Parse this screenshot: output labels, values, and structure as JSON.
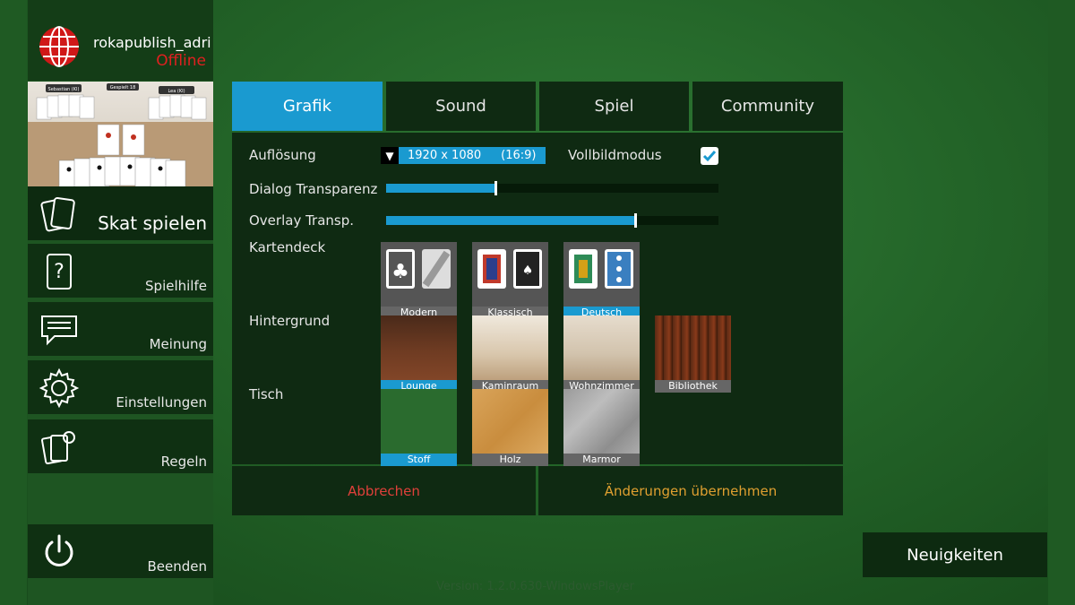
{
  "user": {
    "name": "rokapublish_adri",
    "status": "Offline"
  },
  "preview": {
    "players": [
      "Sebastian (KI)",
      "Lea (KI)"
    ],
    "bid": "Gespielt 18"
  },
  "nav": [
    {
      "label": "Skat spielen",
      "icon": "cards-icon"
    },
    {
      "label": "Spielhilfe",
      "icon": "help-card-icon"
    },
    {
      "label": "Meinung",
      "icon": "chat-icon"
    },
    {
      "label": "Einstellungen",
      "icon": "gear-icon"
    },
    {
      "label": "Regeln",
      "icon": "rules-cards-icon"
    },
    {
      "label": "Beenden",
      "icon": "power-icon"
    }
  ],
  "tabs": [
    "Grafik",
    "Sound",
    "Spiel",
    "Community"
  ],
  "active_tab": "Grafik",
  "settings": {
    "resolution_label": "Auflösung",
    "resolution_value": "1920 x 1080",
    "resolution_ratio": "(16:9)",
    "fullscreen_label": "Vollbildmodus",
    "fullscreen_checked": true,
    "dialog_transparency_label": "Dialog Transparenz",
    "dialog_transparency_value": 0.33,
    "overlay_transparency_label": "Overlay Transp.",
    "overlay_transparency_value": 0.75,
    "deck_label": "Kartendeck",
    "decks": [
      "Modern",
      "Klassisch",
      "Deutsch"
    ],
    "deck_selected": "Deutsch",
    "background_label": "Hintergrund",
    "backgrounds": [
      "Lounge",
      "Kaminraum",
      "Wohnzimmer",
      "Bibliothek"
    ],
    "background_selected": "Lounge",
    "table_label": "Tisch",
    "tables": [
      "Stoff",
      "Holz",
      "Marmor"
    ],
    "table_selected": "Stoff"
  },
  "buttons": {
    "cancel": "Abbrechen",
    "apply": "Änderungen übernehmen"
  },
  "news": "Neuigkeiten",
  "version": "Version: 1.2.0.630-WindowsPlayer",
  "colors": {
    "accent": "#1a9ad0",
    "cancel": "#e0403a",
    "apply": "#e0a030",
    "status_offline": "#e02020"
  }
}
